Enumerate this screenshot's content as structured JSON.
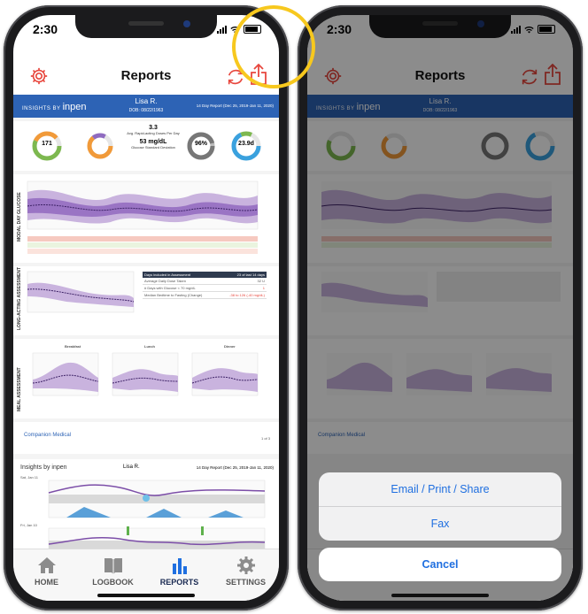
{
  "status": {
    "time": "2:30"
  },
  "nav": {
    "title": "Reports"
  },
  "report": {
    "brand_prefix": "INSIGHTS BY",
    "brand_name": "inpen",
    "patient_name": "Lisa R.",
    "dob": "DOB: 08/22/1963",
    "range": "14 Day Report (Dec 25, 2019-Jan 11, 2020)",
    "avg_doses": "3.3",
    "avg_doses_label": "Avg. Rapid-acting Doses Per Day",
    "std_dev": "53 mg/dL",
    "std_dev_label": "Glucose Standard Deviation",
    "avg_glucose": "171",
    "avg_glucose_unit": "mg/dL",
    "sensor_pct": "96%",
    "gmi": "23.9d",
    "breakfast_label": "Breakfast",
    "lunch_label": "Lunch",
    "dinner_label": "Dinner",
    "section_modal": "MODAL DAY GLUCOSE",
    "section_long": "LONG-ACTING ASSESSMENT",
    "section_meal": "MEAL ASSESSMENT",
    "page_num": "1 of 3",
    "company": "Companion Medical",
    "insights2_title": "Insights by inpen",
    "insights2_patient": "Lisa R.",
    "insights2_range": "14 Day Report (Dec 25, 2019-Jan 11, 2020)",
    "day1": "Sat, Jan 11",
    "day2": "Fri, Jan 10",
    "table_rows": [
      {
        "label": "Days included in Assessment",
        "value": "23 of last 14 days"
      },
      {
        "label": "Average Daily Dose Taken",
        "value": "32 U"
      },
      {
        "label": "# Days with Glucose < 70 mg/dL",
        "value": "1"
      },
      {
        "label": "Median Bedtime to Fasting (Change)",
        "value": "-38 to 126 (-40 mg/dL)"
      }
    ]
  },
  "tabs": [
    {
      "label": "HOME"
    },
    {
      "label": "LOGBOOK"
    },
    {
      "label": "REPORTS"
    },
    {
      "label": "SETTINGS"
    }
  ],
  "sheet": {
    "email_label": "Email / Print / Share",
    "fax_label": "Fax",
    "cancel_label": "Cancel"
  },
  "colors": {
    "accent_red": "#e8483f",
    "brand_blue": "#2d63b5",
    "sheet_blue": "#1f6fe0",
    "highlight_yellow": "#f7c81e",
    "glucose_purple": "#7c4ea8"
  }
}
